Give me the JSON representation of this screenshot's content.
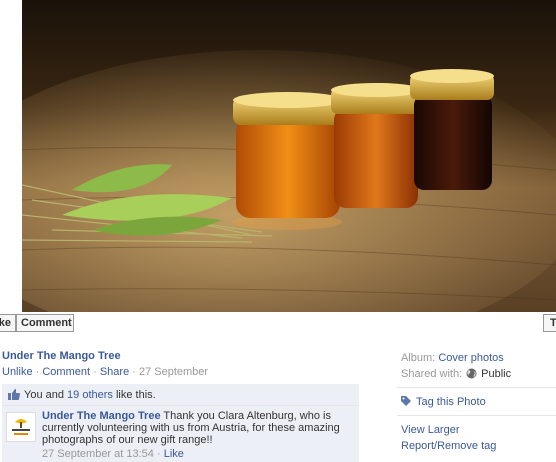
{
  "actions": {
    "like_label": "ke",
    "comment_label": "Comment",
    "right_label": "T"
  },
  "post": {
    "author": "Under The Mango Tree",
    "meta_unlike": "Unlike",
    "meta_comment": "Comment",
    "meta_share": "Share",
    "meta_date": "27 September",
    "sep": " · "
  },
  "likes": {
    "prefix": "You and ",
    "others": "19 others",
    "suffix": " like this."
  },
  "comment": {
    "author": "Under The Mango Tree",
    "text": " Thank you Clara Altenburg, who is currently volunteering with us from Austria, for these amazing photographs of our new gift range!!",
    "timestamp": "27 September at 13:54",
    "like": "Like"
  },
  "sidebar": {
    "album_label": "Album:",
    "album_value": "Cover photos",
    "shared_label": "Shared with:",
    "shared_value": "Public",
    "tag": "Tag this Photo",
    "view_larger": "View Larger",
    "report": "Report/Remove tag"
  },
  "icons": {
    "thumb": "thumbs-up-icon",
    "globe": "globe-icon",
    "tag": "tag-icon"
  },
  "colors": {
    "link": "#3b5998",
    "feedback_bg": "#eceff5"
  }
}
